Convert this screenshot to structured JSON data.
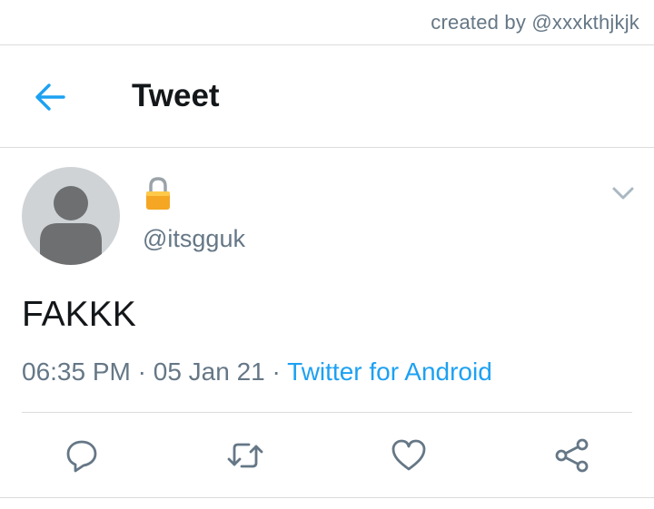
{
  "credit": "created by @xxxkthjkjk",
  "header": {
    "title": "Tweet",
    "back_icon": "arrow-left-icon"
  },
  "tweet": {
    "display_name": "",
    "protected_icon": "lock-icon",
    "handle": "@itsgguk",
    "text": "FAKKK",
    "time": "06:35 PM",
    "separator": " · ",
    "date": "05 Jan 21",
    "source": "Twitter for Android"
  },
  "actions": [
    "reply-icon",
    "retweet-icon",
    "like-icon",
    "share-icon"
  ],
  "colors": {
    "accent": "#1da1f2",
    "muted": "#657786",
    "text": "#14171a",
    "divider": "#dbdbdb",
    "lock": "#f5a623"
  }
}
